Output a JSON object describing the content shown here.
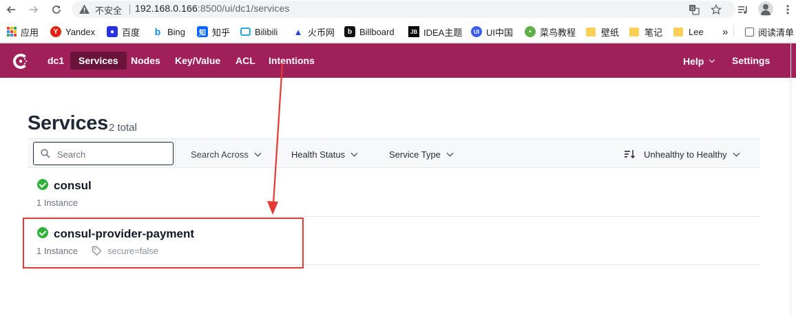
{
  "browser": {
    "insecure_label": "不安全",
    "url_host": "192.168.0.166",
    "url_rest": ":8500/ui/dc1/services"
  },
  "bookmarks": [
    {
      "label": "应用",
      "icon": "apps-grid-icon"
    },
    {
      "label": "Yandex",
      "icon": "yandex-icon",
      "color": "#e32213"
    },
    {
      "label": "百度",
      "icon": "baidu-paw-icon",
      "color": "#2932e1"
    },
    {
      "label": "Bing",
      "icon": "bing-icon",
      "color": "#0c8ce9"
    },
    {
      "label": "知乎",
      "icon": "zhihu-icon",
      "color": "#0a66ff"
    },
    {
      "label": "Bilibili",
      "icon": "bilibili-tv-icon",
      "color": "#20a9e1"
    },
    {
      "label": "火币网",
      "icon": "huobi-flame-icon",
      "color": "#1f4bd8"
    },
    {
      "label": "Billboard",
      "icon": "billboard-icon",
      "color": "#111111"
    },
    {
      "label": "IDEA主题",
      "icon": "jetbrains-icon",
      "color": "#000000"
    },
    {
      "label": "UI中国",
      "icon": "ui-china-icon",
      "color": "#3a5cf0"
    },
    {
      "label": "菜鸟教程",
      "icon": "runoob-icon",
      "color": "#5fb04a"
    },
    {
      "label": "壁纸",
      "icon": "folder-icon"
    },
    {
      "label": "笔记",
      "icon": "folder-icon"
    },
    {
      "label": "Lee",
      "icon": "folder-icon"
    },
    {
      "label": "阅读清单",
      "icon": "reading-list-icon"
    }
  ],
  "bookmarks_overflow": "»",
  "consul": {
    "brand_color": "#a0205a",
    "datacenter": "dc1",
    "nav": [
      "Services",
      "Nodes",
      "Key/Value",
      "ACL",
      "Intentions"
    ],
    "active_nav": "Services",
    "help_label": "Help",
    "settings_label": "Settings"
  },
  "page": {
    "title": "Services",
    "count": "2 total"
  },
  "filters": {
    "search_placeholder": "Search",
    "search_across": "Search Across",
    "health_status": "Health Status",
    "service_type": "Service Type",
    "sort": "Unhealthy to Healthy"
  },
  "services": [
    {
      "name": "consul",
      "instances": "1 Instance",
      "status": "passing"
    },
    {
      "name": "consul-provider-payment",
      "instances": "1 Instance",
      "tag": "secure=false",
      "status": "passing"
    }
  ],
  "annotation": {
    "color": "#e53935",
    "highlighted_service": "consul-provider-payment"
  }
}
